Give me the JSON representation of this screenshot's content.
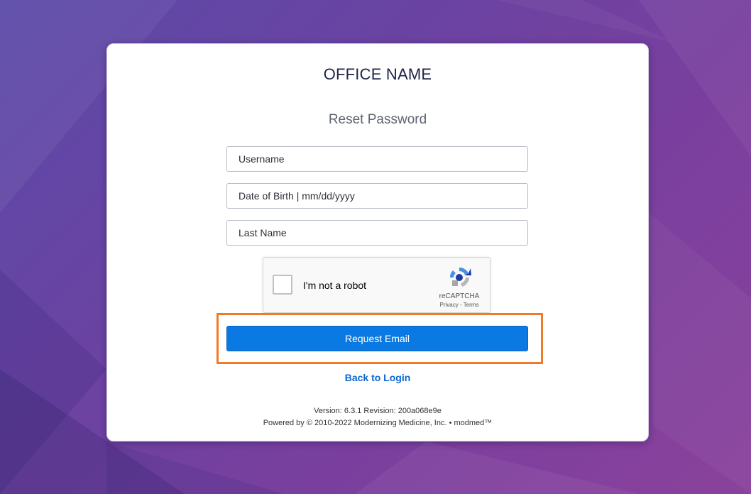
{
  "colors": {
    "background_start": "#5b4aa8",
    "background_end": "#8a429c",
    "accent_button": "#0a7ae2",
    "link": "#0a68cf",
    "highlight": "#f07a2a"
  },
  "header": {
    "office_name": "OFFICE NAME",
    "form_title": "Reset Password"
  },
  "form": {
    "username_placeholder": "Username",
    "dob_placeholder": "Date of Birth | mm/dd/yyyy",
    "last_name_placeholder": "Last Name",
    "username_value": "",
    "dob_value": "",
    "last_name_value": ""
  },
  "recaptcha": {
    "checkbox_label": "I'm not a robot",
    "brand": "reCAPTCHA",
    "privacy_link": "Privacy",
    "separator": " - ",
    "terms_link": "Terms",
    "checked": false,
    "icon": "recaptcha-logo-icon"
  },
  "actions": {
    "request_email_label": "Request Email",
    "back_to_login_label": "Back to Login"
  },
  "footer": {
    "version_line": "Version: 6.3.1 Revision: 200a068e9e",
    "powered_line": "Powered by © 2010-2022 Modernizing Medicine, Inc. • modmed™"
  }
}
